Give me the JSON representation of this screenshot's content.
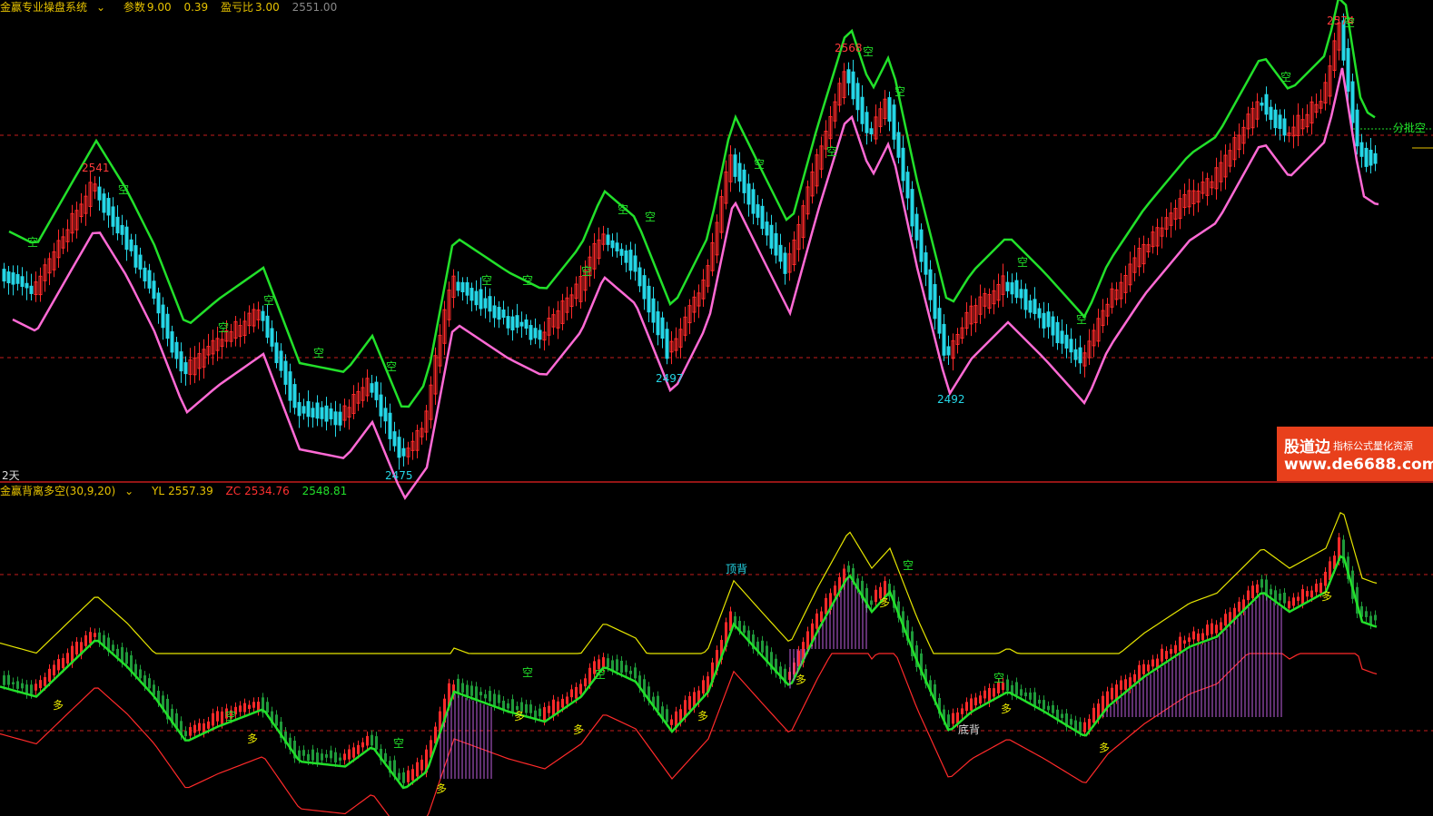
{
  "top_panel": {
    "indicator_name": "金赢专业操盘系统",
    "param_label": "参数",
    "param_value": "9.00",
    "value2": "0.39",
    "profit_ratio_label": "盈亏比",
    "profit_ratio_value": "3.00",
    "price_value": "2551.00",
    "period_label": "2天",
    "side_label": "分批空",
    "price_marks": {
      "h1": "2541",
      "h2": "2568",
      "h3": "2574",
      "l1": "2475",
      "l2": "2497",
      "l3": "2492"
    },
    "signal_short": "空"
  },
  "bottom_panel": {
    "indicator_name": "金赢背离多空(30,9,20)",
    "yl_label": "YL",
    "yl_value": "2557.39",
    "zc_label": "ZC",
    "zc_value": "2534.76",
    "value3": "2548.81",
    "top_divergence": "顶背",
    "bottom_divergence": "底背",
    "signal_long": "多",
    "signal_short": "空"
  },
  "watermark": {
    "brand": "股道边",
    "tagline": "指标公式量化资源",
    "url": "www.de6688.com"
  },
  "colors": {
    "bg": "#000000",
    "up": "#ff2a2a",
    "down": "#25d6e6",
    "support": "#ff6ad5",
    "resistance": "#22e02a",
    "divider": "#c41c1c",
    "yellow": "#e6e600",
    "vol_bar": "#c060e0",
    "low_green": "#1f9a3a"
  },
  "icons": {
    "dropdown": "chevron-down-icon",
    "long_arrow": "up-arrow-icon",
    "short_arrow": "down-arrow-icon"
  }
}
